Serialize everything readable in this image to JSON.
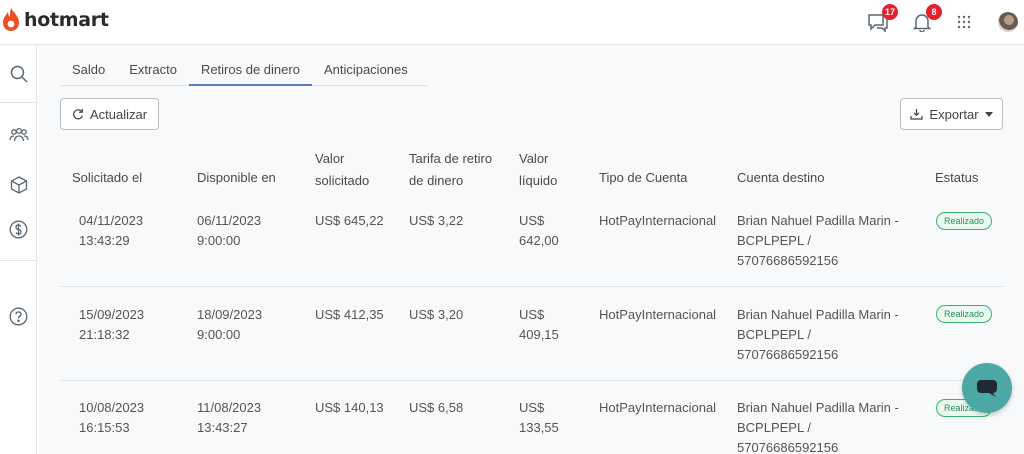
{
  "brand": {
    "name": "hotmart",
    "color": "#ef4e23"
  },
  "header": {
    "messages_count": "17",
    "notifications_count": "8"
  },
  "tabs": [
    {
      "label": "Saldo",
      "active": false
    },
    {
      "label": "Extracto",
      "active": false
    },
    {
      "label": "Retiros de dinero",
      "active": true
    },
    {
      "label": "Anticipaciones",
      "active": false
    }
  ],
  "toolbar": {
    "refresh_label": "Actualizar",
    "export_label": "Exportar"
  },
  "table": {
    "headers": {
      "requested": "Solicitado el",
      "available": "Disponible en",
      "value_requested": [
        "Valor",
        "solicitado"
      ],
      "fee": [
        "Tarifa de retiro",
        "de dinero"
      ],
      "net": [
        "Valor",
        "líquido"
      ],
      "account_type": "Tipo de Cuenta",
      "destination": "Cuenta destino",
      "status": "Estatus"
    },
    "rows": [
      {
        "requested": [
          "04/11/2023",
          "13:43:29"
        ],
        "available": [
          "06/11/2023",
          "9:00:00"
        ],
        "value_requested": "US$ 645,22",
        "fee": "US$ 3,22",
        "net": [
          "US$",
          "642,00"
        ],
        "account_type": "HotPayInternacional",
        "destination": [
          "Brian Nahuel Padilla Marin -",
          "BCPLPEPL /",
          "57076686592156"
        ],
        "status": "Realizado"
      },
      {
        "requested": [
          "15/09/2023",
          "21:18:32"
        ],
        "available": [
          "18/09/2023",
          "9:00:00"
        ],
        "value_requested": "US$ 412,35",
        "fee": "US$ 3,20",
        "net": [
          "US$",
          "409,15"
        ],
        "account_type": "HotPayInternacional",
        "destination": [
          "Brian Nahuel Padilla Marin -",
          "BCPLPEPL /",
          "57076686592156"
        ],
        "status": "Realizado"
      },
      {
        "requested": [
          "10/08/2023",
          "16:15:53"
        ],
        "available": [
          "11/08/2023",
          "13:43:27"
        ],
        "value_requested": "US$ 140,13",
        "fee": "US$ 6,58",
        "net": [
          "US$",
          "133,55"
        ],
        "account_type": "HotPayInternacional",
        "destination": [
          "Brian Nahuel Padilla Marin -",
          "BCPLPEPL /",
          "57076686592156"
        ],
        "status": "Realizado"
      }
    ]
  },
  "icons": {
    "sidebar": [
      "search-icon",
      "users-icon",
      "product-box-icon",
      "dollar-icon",
      "help-icon"
    ],
    "header": [
      "chat-icon",
      "bell-icon",
      "apps-grid-icon",
      "avatar"
    ]
  },
  "colors": {
    "accent_tab": "#5b7cc4",
    "status_green": "#38b36d",
    "chat_bubble": "#4ca8a5",
    "badge_red": "#e5202e"
  }
}
